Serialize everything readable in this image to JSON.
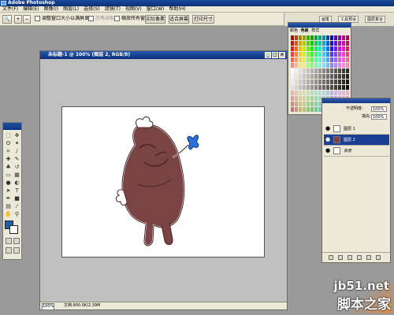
{
  "app": {
    "title": "Adobe Photoshop"
  },
  "menubar": [
    "文件(F)",
    "编辑(E)",
    "图像(I)",
    "图层(L)",
    "选择(S)",
    "滤镜(T)",
    "视图(V)",
    "窗口(W)",
    "帮助(H)"
  ],
  "options": {
    "resize_windows_label": "调整窗口大小以满屏显示",
    "ignore_palettes_label": "忽略调板",
    "zoom_all_label": "缩放所有窗口",
    "actual_pixels": "实际像素",
    "fit_screen": "适合屏幕",
    "print_size": "打印尺寸"
  },
  "palette_well": [
    "画笔",
    "工具预设",
    "图层复合"
  ],
  "document": {
    "title": "未标题-1 @ 100% (图层 2, RGB/8)",
    "zoom": "100%",
    "file_info": "文档:900.0K/2.39M"
  },
  "swatches": {
    "tabs": [
      "颜色",
      "色板",
      "样式"
    ]
  },
  "layers": {
    "opacity_label": "不透明度:",
    "opacity_value": "100%",
    "fill_label": "填充:",
    "fill_value": "100%",
    "items": [
      {
        "name": "图层 1",
        "selected": false
      },
      {
        "name": "图层 2",
        "selected": true
      },
      {
        "name": "背景",
        "selected": false,
        "italic": true
      }
    ]
  },
  "watermark": {
    "site": "jb51.net",
    "name": "脚本之家"
  },
  "colors": {
    "foreground": "#1a5fb4",
    "background": "#ffffff",
    "character_body": "#7a4344",
    "butterfly": "#2f6fd6"
  }
}
